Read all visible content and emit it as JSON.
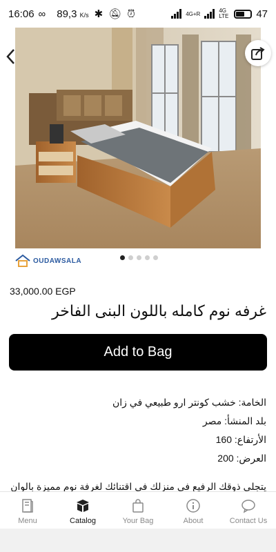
{
  "status": {
    "time": "16:06",
    "infinity": "∞",
    "speed": "89,3",
    "speed_unit": "K/s",
    "net1": "4G+R",
    "net2": "4G LTE",
    "battery": "47"
  },
  "product": {
    "image_count": 5,
    "active_image_index": 0,
    "brand_logo_text": "OUDAWSALA",
    "price": "33,000.00 EGP",
    "title": "غرفه نوم كامله باللون البنى الفاخر",
    "add_to_bag_label": "Add to Bag",
    "specs": [
      "الخامة: خشب كونتر ارو طبيعي في زان",
      "بلد المنشأ: مصر",
      "الأرتفاع: 160",
      "العرض: 200"
    ],
    "description_preview": "يتجلى ذوقك الرفيع فى منزلك فى اقتنائك لغرفة نوم مميزة بالوان"
  },
  "tabs": [
    {
      "label": "Menu",
      "icon": "book-icon"
    },
    {
      "label": "Catalog",
      "icon": "box-icon"
    },
    {
      "label": "Your Bag",
      "icon": "bag-icon"
    },
    {
      "label": "About",
      "icon": "info-icon"
    },
    {
      "label": "Contact Us",
      "icon": "chat-icon"
    }
  ],
  "active_tab": "Catalog"
}
